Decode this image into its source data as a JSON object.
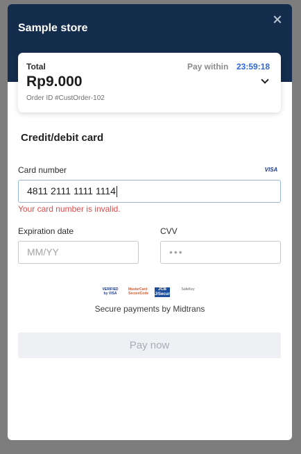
{
  "modal": {
    "store_name": "Sample store",
    "close_icon": "close-icon"
  },
  "summary": {
    "total_label": "Total",
    "amount": "Rp9.000",
    "order_id": "Order ID #CustOrder-102",
    "pay_within_label": "Pay within",
    "timer": "23:59:18",
    "expand_icon": "chevron-down-icon"
  },
  "form": {
    "section_title": "Credit/debit card",
    "card_number_label": "Card number",
    "card_brand": "VISA",
    "card_number_value": "4811 2111 1111 1114",
    "card_number_error": "Your card number is invalid.",
    "expiry_label": "Expiration date",
    "expiry_placeholder": "MM/YY",
    "cvv_label": "CVV",
    "cvv_placeholder": "•••"
  },
  "trust": {
    "badges": {
      "visa": "VERIFIED by VISA",
      "mastercard": "MasterCard SecureCode",
      "jcb": "JCB J/Secure",
      "safekey": "SafeKey"
    },
    "secure_text": "Secure payments by Midtrans"
  },
  "actions": {
    "pay_label": "Pay now"
  },
  "colors": {
    "header": "#142d4c",
    "timer": "#2f67d8",
    "error": "#e04a4a",
    "button_disabled": "#eef0f4"
  }
}
